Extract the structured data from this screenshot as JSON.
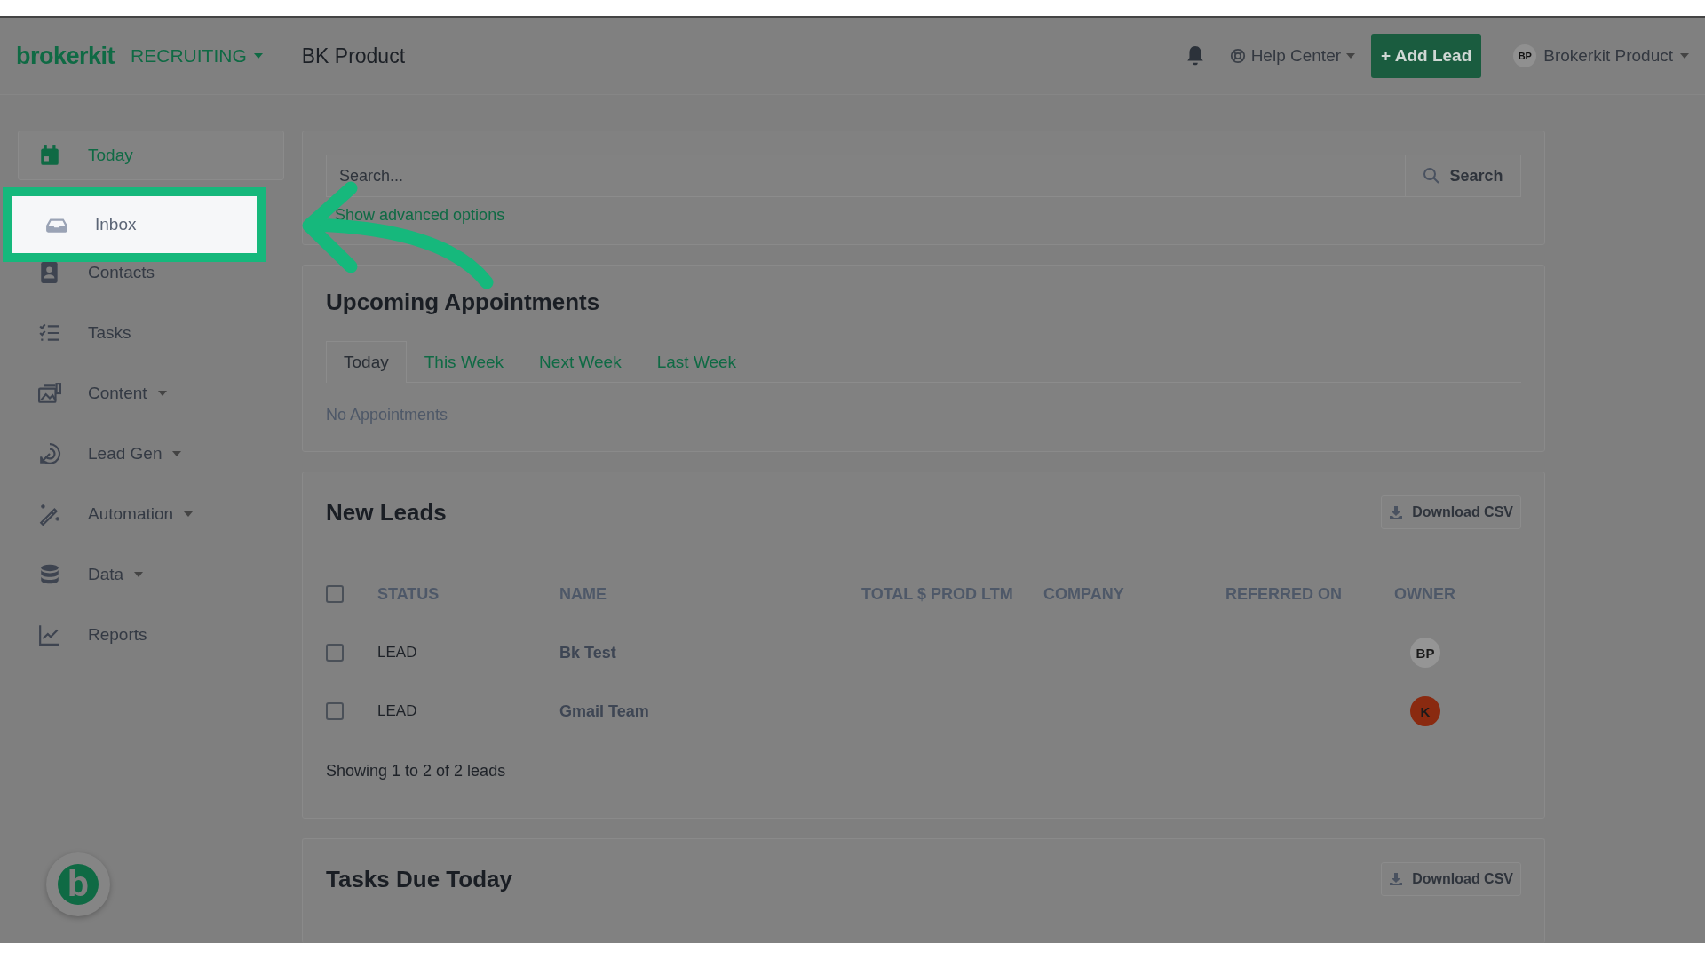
{
  "header": {
    "logo": "brokerkit",
    "mode": "RECRUITING",
    "page_title": "BK Product",
    "help": "Help Center",
    "add_button": "+ Add Lead",
    "user_initials": "BP",
    "user_name": "Brokerkit Product"
  },
  "sidebar": {
    "items": [
      {
        "label": "Today",
        "has_menu": false,
        "selected": true,
        "highlighted": false
      },
      {
        "label": "Inbox",
        "has_menu": false,
        "selected": false,
        "highlighted": true
      },
      {
        "label": "Contacts",
        "has_menu": false,
        "selected": false,
        "highlighted": false
      },
      {
        "label": "Tasks",
        "has_menu": false,
        "selected": false,
        "highlighted": false
      },
      {
        "label": "Content",
        "has_menu": true,
        "selected": false,
        "highlighted": false
      },
      {
        "label": "Lead Gen",
        "has_menu": true,
        "selected": false,
        "highlighted": false
      },
      {
        "label": "Automation",
        "has_menu": true,
        "selected": false,
        "highlighted": false
      },
      {
        "label": "Data",
        "has_menu": true,
        "selected": false,
        "highlighted": false
      },
      {
        "label": "Reports",
        "has_menu": false,
        "selected": false,
        "highlighted": false
      }
    ],
    "chat_logo": "b"
  },
  "search": {
    "placeholder": "Search...",
    "button": "Search",
    "advanced_link": "Show advanced options"
  },
  "appointments": {
    "title": "Upcoming Appointments",
    "tabs": [
      {
        "label": "Today",
        "selected": true
      },
      {
        "label": "This Week",
        "selected": false
      },
      {
        "label": "Next Week",
        "selected": false
      },
      {
        "label": "Last Week",
        "selected": false
      }
    ],
    "empty": "No Appointments"
  },
  "new_leads": {
    "title": "New Leads",
    "download": "Download CSV",
    "columns": [
      "STATUS",
      "NAME",
      "TOTAL $ PROD LTM",
      "COMPANY",
      "REFERRED ON",
      "OWNER"
    ],
    "header_checked": false,
    "rows": [
      {
        "checked": false,
        "status": "LEAD",
        "name": "Bk Test",
        "owner": "BP",
        "color": "#959595"
      },
      {
        "checked": false,
        "status": "LEAD",
        "name": "Gmail Team",
        "owner": "K",
        "color": "#8a2a10"
      }
    ],
    "footer": "Showing 1 to 2 of 2 leads"
  },
  "tasks_due": {
    "title": "Tasks Due Today",
    "download": "Download CSV"
  }
}
